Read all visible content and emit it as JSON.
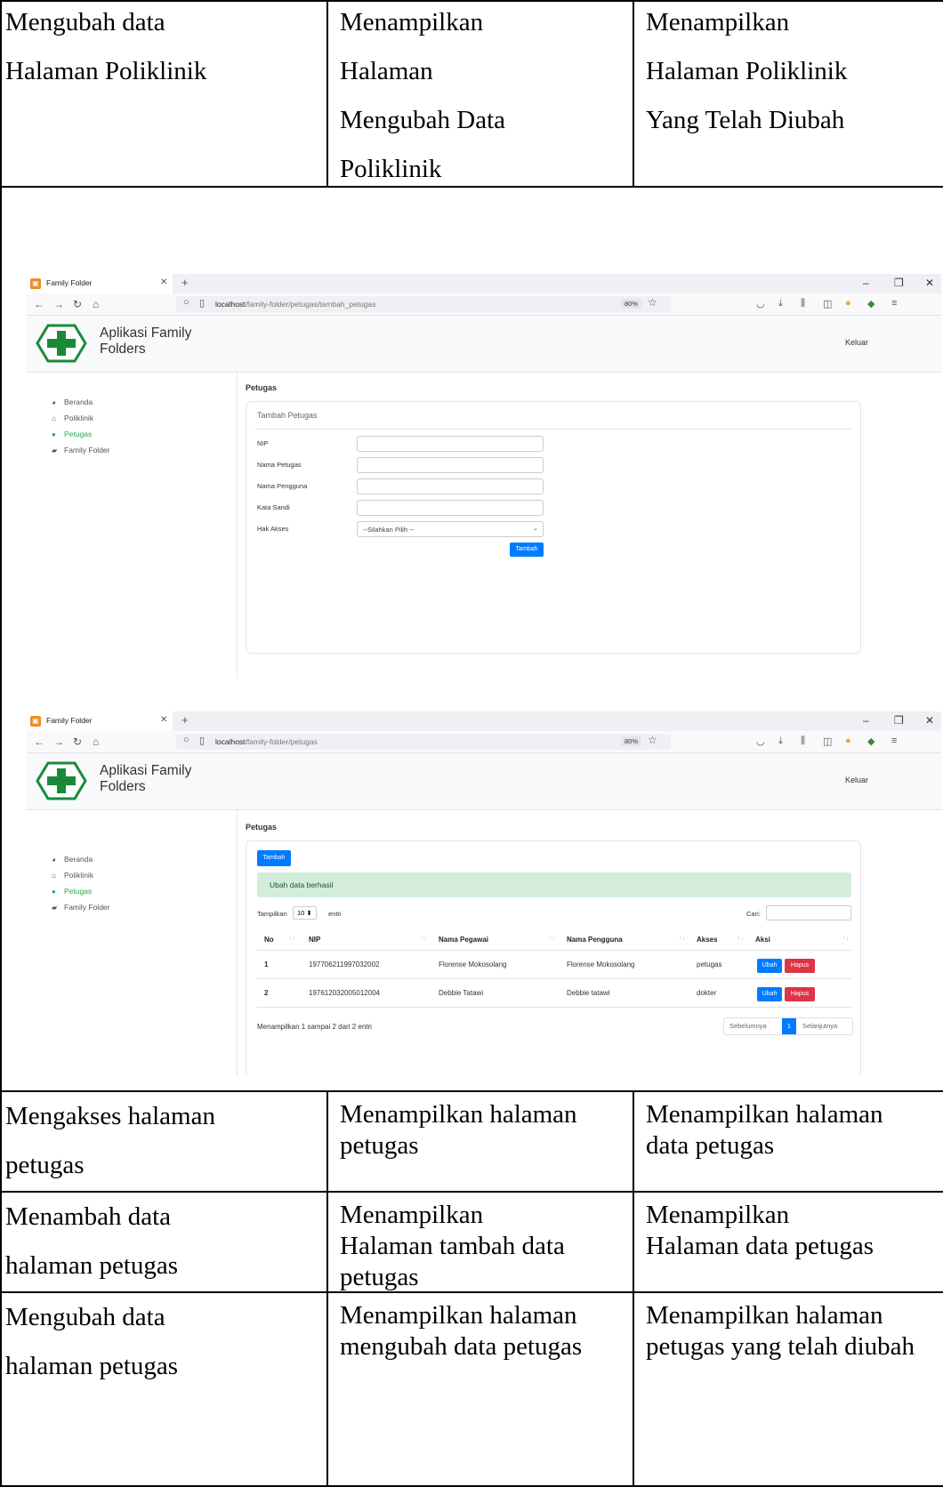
{
  "table_top": {
    "col1": "Mengubah data\nHalaman Poliklinik",
    "col2": "Menampilkan\nHalaman\nMengubah Data\nPoliklinik",
    "col3": "Menampilkan\nHalaman Poliklinik\nYang Telah Diubah"
  },
  "screenshot1": {
    "tab_title": "Family Folder",
    "url_host": "localhost",
    "url_path": "/family-folder/petugas/tambah_petugas",
    "zoom": "80%",
    "app_name": "Aplikasi Family Folders",
    "logout": "Keluar",
    "sidebar": [
      "Beranda",
      "Poliklinik",
      "Petugas",
      "Family Folder"
    ],
    "page_title": "Petugas",
    "card_title": "Tambah Petugas",
    "fields": [
      "NIP",
      "Nama Petugas",
      "Nama Pengguna",
      "Kata Sandi",
      "Hak Akses"
    ],
    "select_placeholder": "--Silahkan Pilih --",
    "submit": "Tambah"
  },
  "screenshot2": {
    "tab_title": "Family Folder",
    "url_host": "localhost",
    "url_path": "/family-folder/petugas",
    "zoom": "80%",
    "app_name": "Aplikasi Family Folders",
    "logout": "Keluar",
    "sidebar": [
      "Beranda",
      "Poliklinik",
      "Petugas",
      "Family Folder"
    ],
    "page_title": "Petugas",
    "add_button": "Tambah",
    "alert": "Ubah data berhasil",
    "show_prefix": "Tampilkan",
    "show_value": "10",
    "show_suffix": "entri",
    "search_label": "Cari:",
    "columns": [
      "No",
      "NIP",
      "Nama Pegawai",
      "Nama Pengguna",
      "Akses",
      "Aksi"
    ],
    "rows": [
      {
        "no": "1",
        "nip": "197706211997032002",
        "nama": "Florense Mokosolang",
        "pengguna": "Florense Mokosolang",
        "akses": "petugas"
      },
      {
        "no": "2",
        "nip": "197612032005012004",
        "nama": "Debbie Tatawi",
        "pengguna": "Debbie tatawi",
        "akses": "dokter"
      }
    ],
    "edit_label": "Ubah",
    "delete_label": "Hapus",
    "info": "Menampilkan 1 sampai 2 dari 2 entri",
    "prev": "Sebelumnya",
    "page": "1",
    "next": "Selanjutnya"
  },
  "table_bottom": [
    {
      "col1": "Mengakses halaman\npetugas",
      "col2": "Menampilkan halaman\npetugas",
      "col3": "Menampilkan halaman\ndata petugas"
    },
    {
      "col1": "Menambah data\nhalaman petugas",
      "col2": "Menampilkan\nHalaman tambah data\npetugas",
      "col3": "Menampilkan\nHalaman data petugas"
    },
    {
      "col1": "Mengubah data\nhalaman petugas",
      "col2": "Menampilkan halaman\nmengubah data petugas",
      "col3": "Menampilkan halaman\npetugas yang telah diubah"
    }
  ],
  "colors": {
    "accent_green": "#28a745",
    "primary_blue": "#007bff",
    "danger_red": "#dc3545",
    "alert_bg": "#d4edda"
  }
}
